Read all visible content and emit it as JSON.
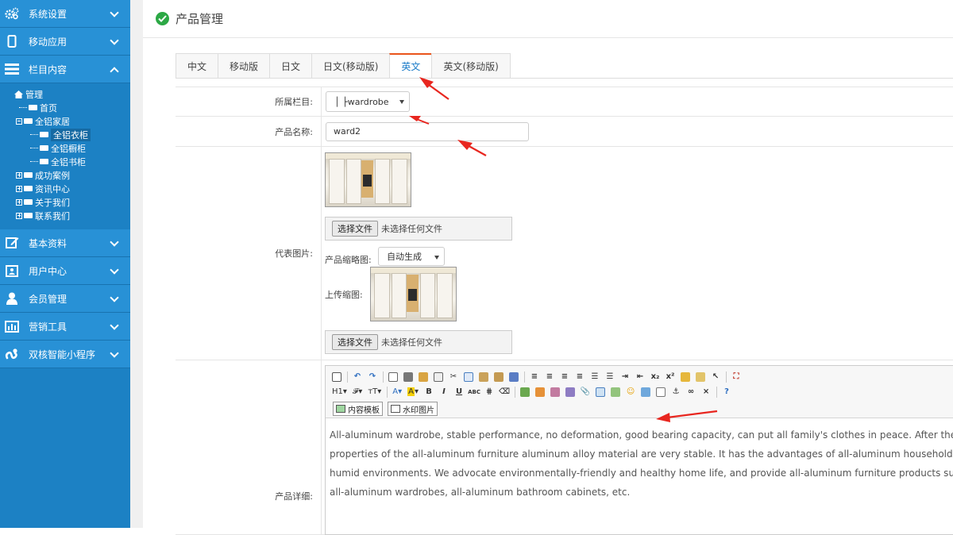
{
  "sidebar": {
    "items_top": [
      {
        "label": "系统设置",
        "icon": "gears-icon"
      },
      {
        "label": "移动应用",
        "icon": "mobile-icon"
      },
      {
        "label": "栏目内容",
        "icon": "list-icon"
      }
    ],
    "tree": [
      {
        "label": "管理"
      },
      {
        "label": "首页"
      },
      {
        "label": "全铝家居"
      },
      {
        "label": "全铝衣柜"
      },
      {
        "label": "全铝橱柜"
      },
      {
        "label": "全铝书柜"
      },
      {
        "label": "成功案例"
      },
      {
        "label": "资讯中心"
      },
      {
        "label": "关于我们"
      },
      {
        "label": "联系我们"
      }
    ],
    "items_bottom": [
      {
        "label": "基本资料",
        "icon": "edit-icon"
      },
      {
        "label": "用户中心",
        "icon": "user-card-icon"
      },
      {
        "label": "会员管理",
        "icon": "person-icon"
      },
      {
        "label": "营销工具",
        "icon": "bar-chart-icon"
      },
      {
        "label": "双核智能小程序",
        "icon": "miniprogram-icon"
      }
    ]
  },
  "header": {
    "title": "产品管理"
  },
  "tabs": [
    {
      "label": "中文"
    },
    {
      "label": "移动版"
    },
    {
      "label": "日文"
    },
    {
      "label": "日文(移动版)"
    },
    {
      "label": "英文"
    },
    {
      "label": "英文(移动版)"
    }
  ],
  "form": {
    "column_label": "所属栏目:",
    "column_value": "│ ├wardrobe",
    "name_label": "产品名称:",
    "name_value": "ward2",
    "image_label": "代表图片:",
    "choose_file": "选择文件",
    "no_file": "未选择任何文件",
    "thumb_label": "产品缩略图:",
    "thumb_value": "自动生成",
    "upload_thumb_label": "上传缩图:",
    "detail_label": "产品详细:"
  },
  "editor": {
    "heading_btn": "H1",
    "content_template": "内容模板",
    "watermark": "水印图片",
    "body_lines": [
      "All-aluminum wardrobe, stable performance, no deformation, good bearing capacity, can put all family's clothes in peace. After the alumi",
      "properties of the all-aluminum furniture aluminum alloy material are very stable. It has the advantages of all-aluminum household feature",
      "humid environments. We advocate environmentally-friendly and healthy home life, and provide all-aluminum furniture products such as",
      "all-aluminum wardrobes, all-aluminum bathroom cabinets, etc."
    ]
  },
  "colors": {
    "sidebar": "#1c81c4",
    "annotation_arrow": "#e8261f",
    "active_tab_text": "#1a7bc8"
  }
}
